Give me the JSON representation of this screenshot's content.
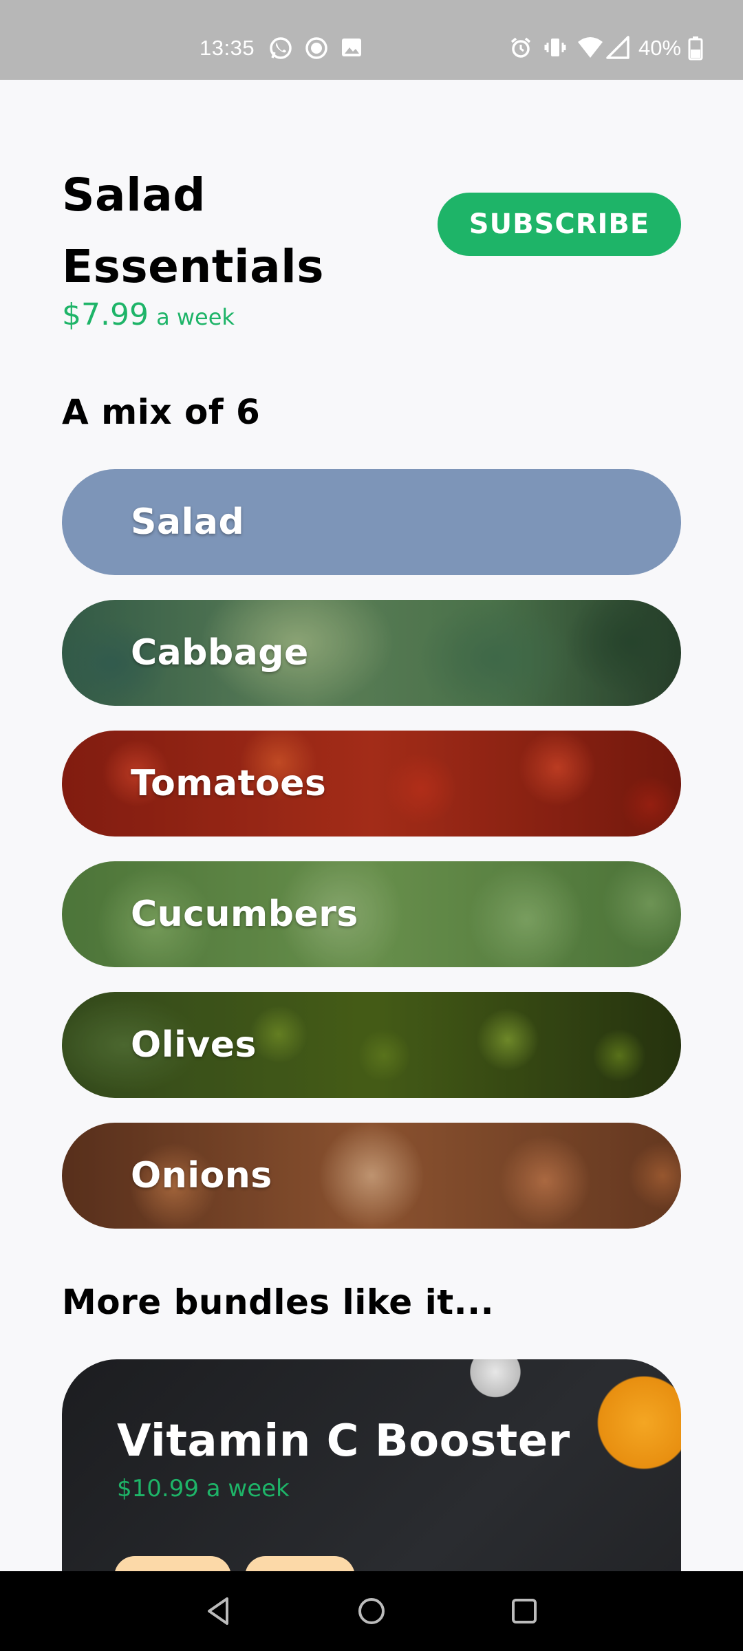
{
  "status_bar": {
    "time": "13:35",
    "battery": "40%",
    "left_icons": [
      "whatsapp-icon",
      "record-icon",
      "image-icon"
    ],
    "right_icons": [
      "alarm-icon",
      "vibrate-icon",
      "wifi-icon",
      "signal-icon",
      "battery-icon"
    ]
  },
  "header": {
    "title": "Salad Essentials",
    "price": "$7.99",
    "per": "a week",
    "subscribe_label": "SUBSCRIBE"
  },
  "mix": {
    "heading": "A mix of 6",
    "items": [
      {
        "label": "Salad"
      },
      {
        "label": "Cabbage"
      },
      {
        "label": "Tomatoes"
      },
      {
        "label": "Cucumbers"
      },
      {
        "label": "Olives"
      },
      {
        "label": "Onions"
      }
    ]
  },
  "more": {
    "heading": "More bundles like it...",
    "bundle": {
      "title": "Vitamin C Booster",
      "price": "$10.99 a week"
    }
  },
  "nav": [
    "back-icon",
    "home-icon",
    "recents-icon"
  ],
  "colors": {
    "accent": "#1eb468",
    "status_bar": "#b7b7b7",
    "background": "#f8f8fa",
    "salad_pill": "#7d95b8"
  }
}
